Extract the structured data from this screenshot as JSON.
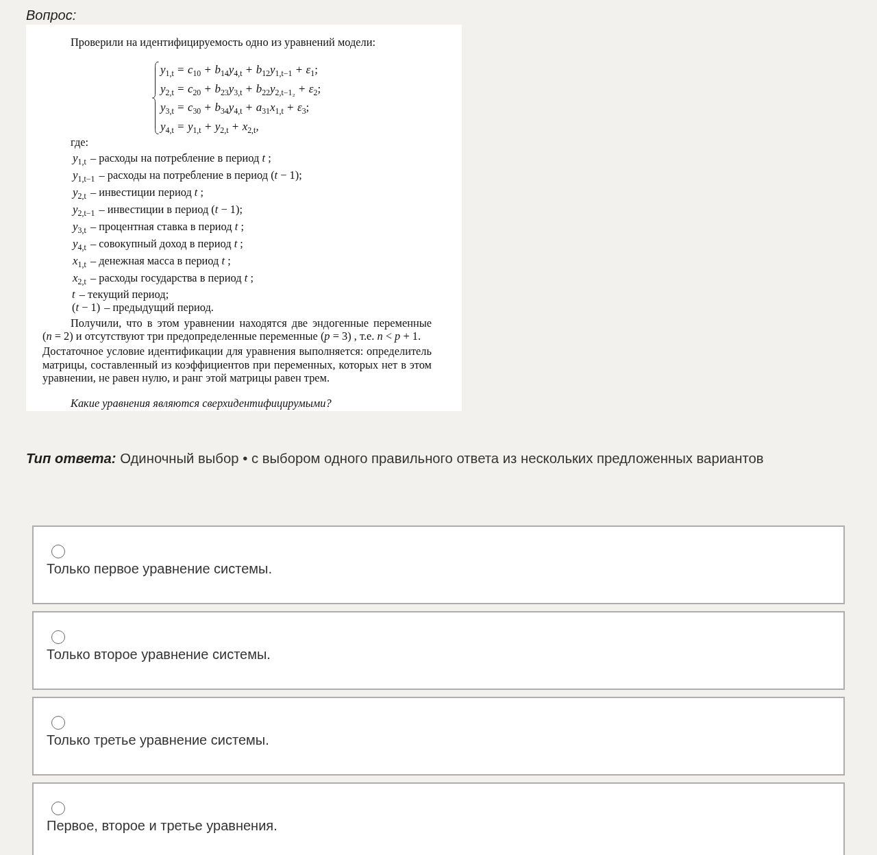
{
  "question": {
    "label": "Вопрос:",
    "document": {
      "intro": "Проверили на идентифицируемость одно из уравнений модели:",
      "equations": [
        "*y*$_{1,t}$ = *c*$_{10}$ + *b*$_{14}$*y*$_{4,t}$ + *b*$_{12}$*y*$_{1,t−1}$ + *ε*$_{1}$;",
        "*y*$_{2,t}$ = *c*$_{20}$ + *b*$_{23}$*y*$_{3,t}$ + *b*$_{22}$*y*$_{2,t−1₂}$ + *ε*$_{2}$;",
        "*y*$_{3,t}$ = *c*$_{30}$ + *b*$_{34}$*y*$_{4,t}$ + *a*$_{31}$*x*$_{1,t}$ + *ε*$_{3}$;",
        "*y*$_{4,t}$ = *y*$_{1,t}$ + *y*$_{2,t}$ + *x*$_{2,t}$,"
      ],
      "where_label": "где:",
      "variables": [
        {
          "symbol": "*y*$_{1,t}$",
          "text": "– расходы на потребление в период *t* ;"
        },
        {
          "symbol": "*y*$_{1,t−1}$",
          "text": "– расходы на потребление в период (*t* − 1);"
        },
        {
          "symbol": "*y*$_{2,t}$",
          "text": "– инвестиции период *t* ;"
        },
        {
          "symbol": "*y*$_{2,t−1}$",
          "text": "– инвестиции в период (*t* − 1);"
        },
        {
          "symbol": "*y*$_{3,t}$",
          "text": "– процентная ставка в период *t* ;"
        },
        {
          "symbol": "*y*$_{4,t}$",
          "text": "– совокупный доход в период *t* ;"
        },
        {
          "symbol": "*x*$_{1,t}$",
          "text": "– денежная масса в период *t* ;"
        },
        {
          "symbol": "*x*$_{2,t}$",
          "text": "– расходы государства в период *t* ;"
        }
      ],
      "periods": [
        {
          "symbol": "*t*",
          "text": "– текущий период;"
        },
        {
          "symbol": "(*t* − 1)",
          "text": "– предыдущий период."
        }
      ],
      "paragraphs": [
        {
          "kind": "indented",
          "text": "Получили, что в этом уравнении находятся две эндогенные переменные (*n* = 2) и отсутствуют три предопределенные переменные (*p* = 3) , т.е. *n* < *p* + 1."
        },
        {
          "kind": "plain",
          "text": "Достаточное условие идентификации для уравнения выполняется: определитель матрицы, составленный из коэффициентов при переменных, которых нет в этом уравнении, не равен нулю, и ранг этой матрицы равен трем."
        }
      ],
      "question": "Какие уравнения являются сверхидентифицирумыми?"
    }
  },
  "answer_type": {
    "label": "Тип ответа:",
    "value": "Одиночный выбор • с выбором одного правильного ответа из нескольких предложенных вариантов"
  },
  "options": [
    {
      "text": "Только первое уравнение системы.",
      "selected": false
    },
    {
      "text": "Только второе уравнение системы.",
      "selected": false
    },
    {
      "text": "Только третье уравнение системы.",
      "selected": false
    },
    {
      "text": "Первое, второе и третье уравнения.",
      "selected": false
    }
  ]
}
